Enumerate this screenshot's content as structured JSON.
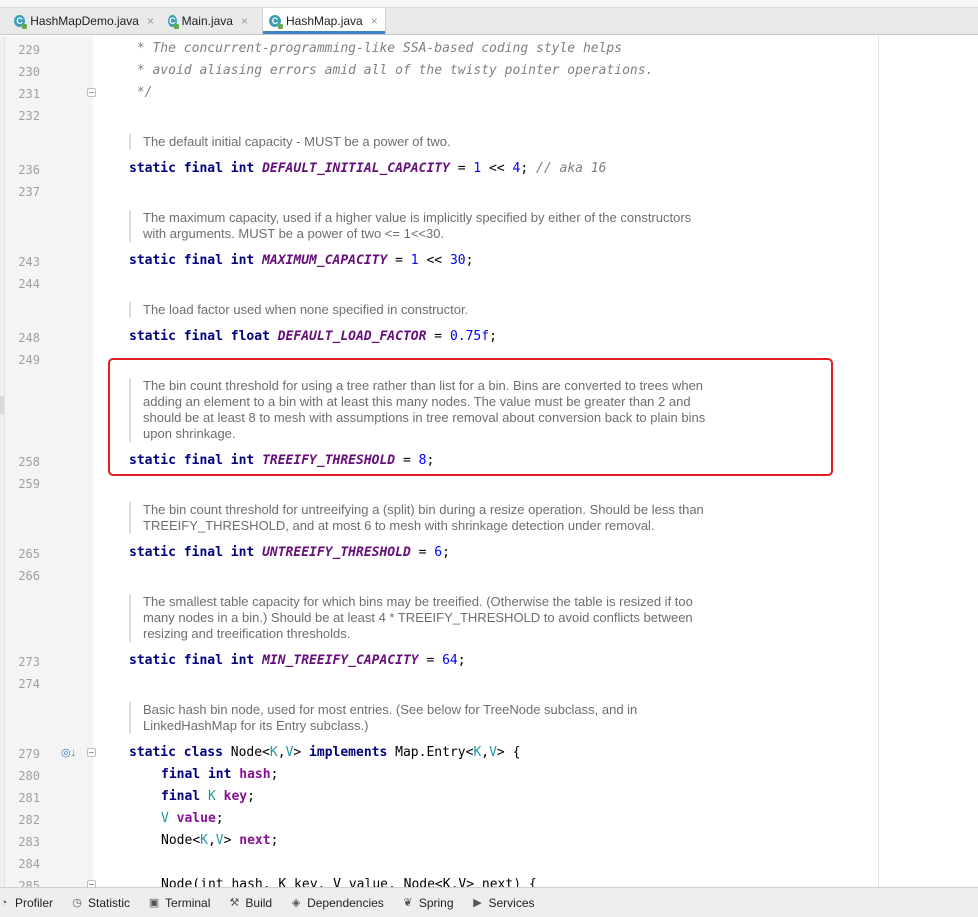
{
  "tabs": [
    {
      "label": "HashMapDemo.java",
      "close": "×"
    },
    {
      "label": "Main.java",
      "close": "×"
    },
    {
      "label": "HashMap.java",
      "close": "×"
    }
  ],
  "tab_icon_letter": "C",
  "lines": {
    "l229": {
      "num": "229",
      "text": " * The concurrent-programming-like SSA-based coding style helps"
    },
    "l230": {
      "num": "230",
      "text": " * avoid aliasing errors amid all of the twisty pointer operations."
    },
    "l231": {
      "num": "231",
      "text": " */"
    },
    "l232": {
      "num": "232"
    },
    "l236": {
      "num": "236"
    },
    "l237": {
      "num": "237"
    },
    "l243": {
      "num": "243"
    },
    "l244": {
      "num": "244"
    },
    "l248": {
      "num": "248"
    },
    "l249": {
      "num": "249"
    },
    "l258": {
      "num": "258"
    },
    "l259": {
      "num": "259"
    },
    "l265": {
      "num": "265"
    },
    "l266": {
      "num": "266"
    },
    "l273": {
      "num": "273"
    },
    "l274": {
      "num": "274"
    },
    "l279": {
      "num": "279"
    },
    "l280": {
      "num": "280"
    },
    "l281": {
      "num": "281"
    },
    "l282": {
      "num": "282"
    },
    "l283": {
      "num": "283"
    },
    "l284": {
      "num": "284"
    },
    "l285": {
      "num": "285"
    }
  },
  "docs": {
    "default_capacity": "The default initial capacity - MUST be a power of two.",
    "max_capacity_1": "The maximum capacity, used if a higher value is implicitly specified by either of the constructors",
    "max_capacity_2": "with arguments. MUST be a power of two <= 1<<30.",
    "load_factor": "The load factor used when none specified in constructor.",
    "treeify_1": "The bin count threshold for using a tree rather than list for a bin. Bins are converted to trees when",
    "treeify_2": "adding an element to a bin with at least this many nodes. The value must be greater than 2 and",
    "treeify_3": "should be at least 8 to mesh with assumptions in tree removal about conversion back to plain bins",
    "treeify_4": "upon shrinkage.",
    "untreeify_1": "The bin count threshold for untreeifying a (split) bin during a resize operation. Should be less than",
    "untreeify_2": "TREEIFY_THRESHOLD, and at most 6 to mesh with shrinkage detection under removal.",
    "min_treeify_1": "The smallest table capacity for which bins may be treeified. (Otherwise the table is resized if too",
    "min_treeify_2": "many nodes in a bin.) Should be at least 4 * TREEIFY_THRESHOLD to avoid conflicts between",
    "min_treeify_3": "resizing and treeification thresholds.",
    "node_1": "Basic hash bin node, used for most entries. (See below for TreeNode subclass, and in",
    "node_2": "LinkedHashMap for its Entry subclass.)"
  },
  "code": {
    "static": "static",
    "final": "final",
    "int": "int",
    "float": "float",
    "class": "class",
    "implements": "implements",
    "c236_name": "DEFAULT_INITIAL_CAPACITY",
    "c236_eq": " = ",
    "c236_v1": "1",
    "c236_op": " << ",
    "c236_v2": "4",
    "c236_semi": "; ",
    "c236_comment": "// aka 16",
    "c243_name": "MAXIMUM_CAPACITY",
    "c243_eq": " = ",
    "c243_v1": "1",
    "c243_op": " << ",
    "c243_v2": "30",
    "c243_semi": ";",
    "c248_name": "DEFAULT_LOAD_FACTOR",
    "c248_eq": " = ",
    "c248_v": "0.75f",
    "c248_semi": ";",
    "c258_name": "TREEIFY_THRESHOLD",
    "c258_eq": " = ",
    "c258_v": "8",
    "c258_semi": ";",
    "c265_name": "UNTREEIFY_THRESHOLD",
    "c265_eq": " = ",
    "c265_v": "6",
    "c265_semi": ";",
    "c273_name": "MIN_TREEIFY_CAPACITY",
    "c273_eq": " = ",
    "c273_v": "64",
    "c273_semi": ";",
    "c279_node": "Node",
    "c279_lt": "<",
    "c279_k": "K",
    "c279_comma": ",",
    "c279_v": "V",
    "c279_gt": ">",
    "c279_entry": "Map.Entry",
    "c279_brace": "{",
    "c280_hash": "hash",
    "c281_k": "K",
    "c281_key": "key",
    "c282_v": "V",
    "c282_value": "value",
    "c283_node": "Node",
    "c283_next": "next",
    "c285_text": "Node(int hash, K key, V value, Node<K,V> next) {"
  },
  "statusbar": [
    {
      "label": "Profiler",
      "icon": "profiler-icon"
    },
    {
      "label": "Statistic",
      "icon": "statistic-icon"
    },
    {
      "label": "Terminal",
      "icon": "terminal-icon"
    },
    {
      "label": "Build",
      "icon": "build-icon"
    },
    {
      "label": "Dependencies",
      "icon": "dependencies-icon"
    },
    {
      "label": "Spring",
      "icon": "spring-icon"
    },
    {
      "label": "Services",
      "icon": "services-icon"
    }
  ],
  "colors": {
    "keyword": "#000080",
    "constant": "#660e7a",
    "number": "#0000ff",
    "highlight_box": "#e02020",
    "active_tab_underline": "#4083c9"
  }
}
